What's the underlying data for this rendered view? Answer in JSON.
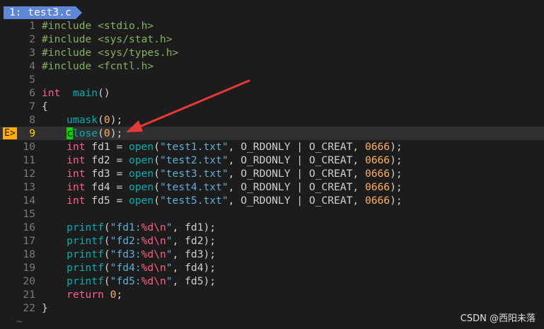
{
  "tab": {
    "label": "1: test3.c"
  },
  "sign_text": "E>",
  "lines": [
    {
      "n": "1",
      "segs": [
        [
          "pp",
          "#include <stdio.h>"
        ]
      ]
    },
    {
      "n": "2",
      "segs": [
        [
          "pp",
          "#include <sys/stat.h>"
        ]
      ]
    },
    {
      "n": "3",
      "segs": [
        [
          "pp",
          "#include <sys/types.h>"
        ]
      ]
    },
    {
      "n": "4",
      "segs": [
        [
          "pp",
          "#include <fcntl.h>"
        ]
      ]
    },
    {
      "n": "5",
      "segs": []
    },
    {
      "n": "6",
      "segs": [
        [
          "kw",
          "int"
        ],
        [
          "",
          "  "
        ],
        [
          "fn",
          "main"
        ],
        [
          "",
          "()"
        ]
      ]
    },
    {
      "n": "7",
      "segs": [
        [
          "",
          "{"
        ]
      ]
    },
    {
      "n": "8",
      "segs": [
        [
          "",
          "    "
        ],
        [
          "fn",
          "umask"
        ],
        [
          "",
          "("
        ],
        [
          "num",
          "0"
        ],
        [
          "",
          ");"
        ]
      ]
    },
    {
      "n": "9",
      "cursor": true,
      "sign": true,
      "segs": [
        [
          "",
          "    "
        ],
        [
          "hl",
          "c"
        ],
        [
          "fn",
          "lose"
        ],
        [
          "",
          "("
        ],
        [
          "num",
          "0"
        ],
        [
          "",
          ");"
        ]
      ]
    },
    {
      "n": "10",
      "segs": [
        [
          "",
          "    "
        ],
        [
          "kw",
          "int"
        ],
        [
          "",
          " fd1 = "
        ],
        [
          "fn",
          "open"
        ],
        [
          "",
          "("
        ],
        [
          "str",
          "\"test1.txt\""
        ],
        [
          "",
          ", O_RDONLY | O_CREAT, "
        ],
        [
          "num",
          "0666"
        ],
        [
          "",
          ");"
        ]
      ]
    },
    {
      "n": "11",
      "segs": [
        [
          "",
          "    "
        ],
        [
          "kw",
          "int"
        ],
        [
          "",
          " fd2 = "
        ],
        [
          "fn",
          "open"
        ],
        [
          "",
          "("
        ],
        [
          "str",
          "\"test2.txt\""
        ],
        [
          "",
          ", O_RDONLY | O_CREAT, "
        ],
        [
          "num",
          "0666"
        ],
        [
          "",
          ");"
        ]
      ]
    },
    {
      "n": "12",
      "segs": [
        [
          "",
          "    "
        ],
        [
          "kw",
          "int"
        ],
        [
          "",
          " fd3 = "
        ],
        [
          "fn",
          "open"
        ],
        [
          "",
          "("
        ],
        [
          "str",
          "\"test3.txt\""
        ],
        [
          "",
          ", O_RDONLY | O_CREAT, "
        ],
        [
          "num",
          "0666"
        ],
        [
          "",
          ");"
        ]
      ]
    },
    {
      "n": "13",
      "segs": [
        [
          "",
          "    "
        ],
        [
          "kw",
          "int"
        ],
        [
          "",
          " fd4 = "
        ],
        [
          "fn",
          "open"
        ],
        [
          "",
          "("
        ],
        [
          "str",
          "\"test4.txt\""
        ],
        [
          "",
          ", O_RDONLY | O_CREAT, "
        ],
        [
          "num",
          "0666"
        ],
        [
          "",
          ");"
        ]
      ]
    },
    {
      "n": "14",
      "segs": [
        [
          "",
          "    "
        ],
        [
          "kw",
          "int"
        ],
        [
          "",
          " fd5 = "
        ],
        [
          "fn",
          "open"
        ],
        [
          "",
          "("
        ],
        [
          "str",
          "\"test5.txt\""
        ],
        [
          "",
          ", O_RDONLY | O_CREAT, "
        ],
        [
          "num",
          "0666"
        ],
        [
          "",
          ");"
        ]
      ]
    },
    {
      "n": "15",
      "segs": []
    },
    {
      "n": "16",
      "segs": [
        [
          "",
          "    "
        ],
        [
          "fn",
          "printf"
        ],
        [
          "",
          "("
        ],
        [
          "str",
          "\"fd1:"
        ],
        [
          "kw",
          "%d\\n"
        ],
        [
          "str",
          "\""
        ],
        [
          "",
          ", fd1);"
        ]
      ]
    },
    {
      "n": "17",
      "segs": [
        [
          "",
          "    "
        ],
        [
          "fn",
          "printf"
        ],
        [
          "",
          "("
        ],
        [
          "str",
          "\"fd2:"
        ],
        [
          "kw",
          "%d\\n"
        ],
        [
          "str",
          "\""
        ],
        [
          "",
          ", fd2);"
        ]
      ]
    },
    {
      "n": "18",
      "segs": [
        [
          "",
          "    "
        ],
        [
          "fn",
          "printf"
        ],
        [
          "",
          "("
        ],
        [
          "str",
          "\"fd3:"
        ],
        [
          "kw",
          "%d\\n"
        ],
        [
          "str",
          "\""
        ],
        [
          "",
          ", fd3);"
        ]
      ]
    },
    {
      "n": "19",
      "segs": [
        [
          "",
          "    "
        ],
        [
          "fn",
          "printf"
        ],
        [
          "",
          "("
        ],
        [
          "str",
          "\"fd4:"
        ],
        [
          "kw",
          "%d\\n"
        ],
        [
          "str",
          "\""
        ],
        [
          "",
          ", fd4);"
        ]
      ]
    },
    {
      "n": "20",
      "segs": [
        [
          "",
          "    "
        ],
        [
          "fn",
          "printf"
        ],
        [
          "",
          "("
        ],
        [
          "str",
          "\"fd5:"
        ],
        [
          "kw",
          "%d\\n"
        ],
        [
          "str",
          "\""
        ],
        [
          "",
          ", fd5);"
        ]
      ]
    },
    {
      "n": "21",
      "segs": [
        [
          "",
          "    "
        ],
        [
          "kw",
          "return"
        ],
        [
          "",
          " "
        ],
        [
          "num",
          "0"
        ],
        [
          "",
          ";"
        ]
      ]
    },
    {
      "n": "22",
      "segs": [
        [
          "",
          "}"
        ]
      ]
    }
  ],
  "tilde": "~",
  "watermark": "CSDN @西阳未落",
  "colors": {
    "arrow": "#e53935",
    "sign_bg": "#ffaf00",
    "tab_bg": "#5f87d7"
  },
  "annotation": {
    "shape": "arrow",
    "points_to": "close(0);"
  }
}
